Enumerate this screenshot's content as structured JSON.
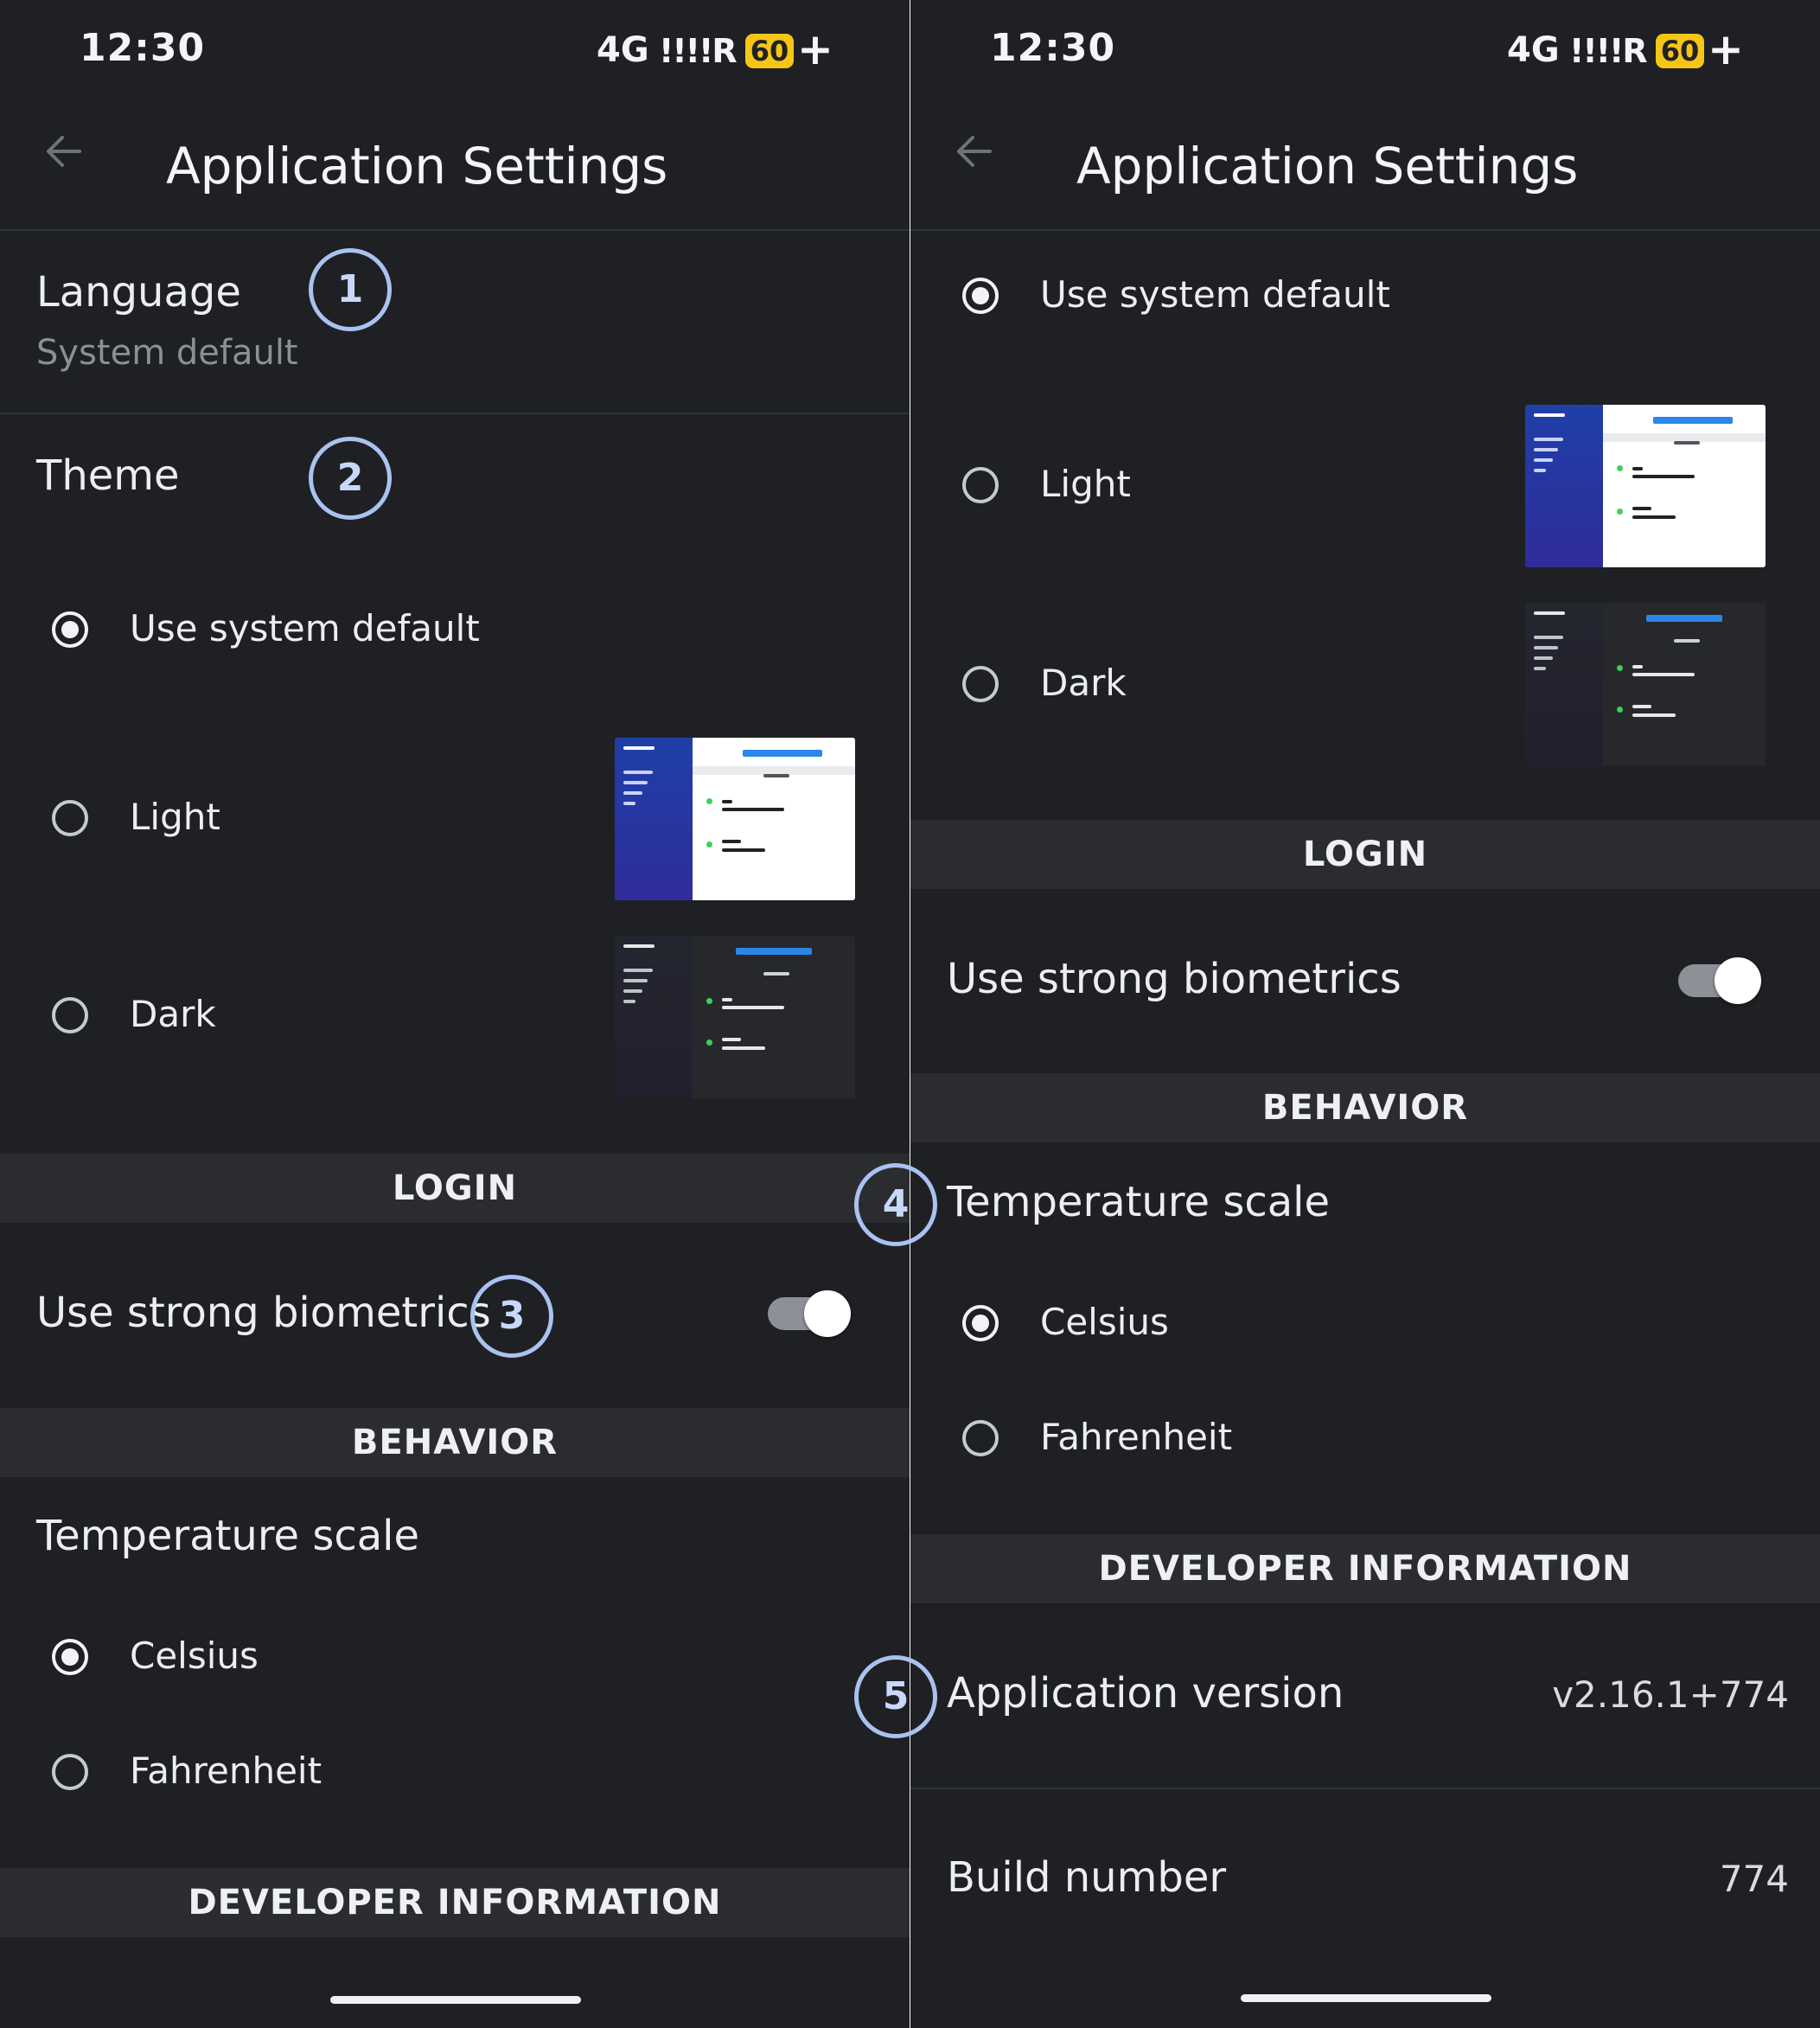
{
  "status_bar": {
    "time": "12:30",
    "network": "4G",
    "signal": "!!!!R",
    "battery": "60",
    "battery_suffix": "+"
  },
  "app_bar": {
    "title": "Application Settings",
    "back_icon": "arrow-left-icon"
  },
  "language": {
    "title": "Language",
    "value": "System default"
  },
  "theme": {
    "title": "Theme",
    "options": [
      {
        "label": "Use system default",
        "selected": true
      },
      {
        "label": "Light",
        "selected": false
      },
      {
        "label": "Dark",
        "selected": false
      }
    ]
  },
  "login": {
    "header": "LOGIN",
    "biometrics_label": "Use strong biometrics",
    "biometrics_enabled": true
  },
  "behavior": {
    "header": "BEHAVIOR",
    "temperature_title": "Temperature scale",
    "options": [
      {
        "label": "Celsius",
        "selected": true
      },
      {
        "label": "Fahrenheit",
        "selected": false
      }
    ]
  },
  "developer": {
    "header": "DEVELOPER INFORMATION",
    "version_label": "Application version",
    "version_value": "v2.16.1+774",
    "build_label": "Build number",
    "build_value": "774"
  },
  "callouts": [
    "1",
    "2",
    "3",
    "4",
    "5"
  ],
  "colors": {
    "background": "#1e2023",
    "section": "#2a2c30",
    "callout": "#a9c2f0"
  }
}
